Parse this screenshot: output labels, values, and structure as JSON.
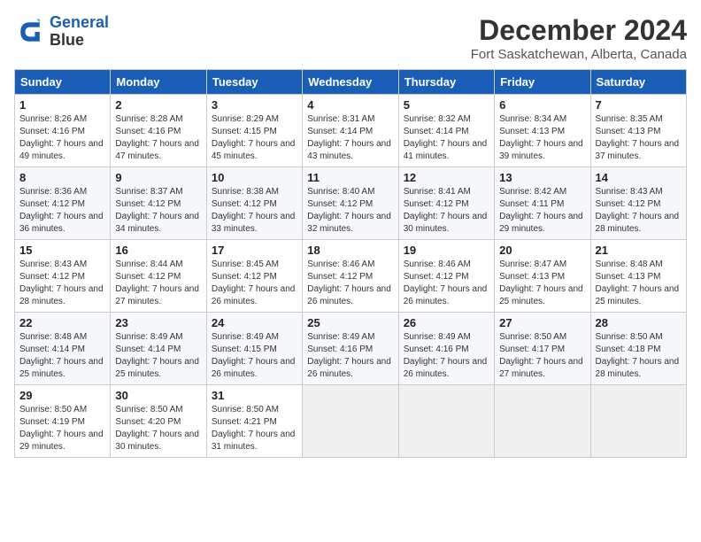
{
  "header": {
    "logo_line1": "General",
    "logo_line2": "Blue",
    "month": "December 2024",
    "location": "Fort Saskatchewan, Alberta, Canada"
  },
  "weekdays": [
    "Sunday",
    "Monday",
    "Tuesday",
    "Wednesday",
    "Thursday",
    "Friday",
    "Saturday"
  ],
  "weeks": [
    [
      {
        "day": "1",
        "sunrise": "Sunrise: 8:26 AM",
        "sunset": "Sunset: 4:16 PM",
        "daylight": "Daylight: 7 hours and 49 minutes."
      },
      {
        "day": "2",
        "sunrise": "Sunrise: 8:28 AM",
        "sunset": "Sunset: 4:16 PM",
        "daylight": "Daylight: 7 hours and 47 minutes."
      },
      {
        "day": "3",
        "sunrise": "Sunrise: 8:29 AM",
        "sunset": "Sunset: 4:15 PM",
        "daylight": "Daylight: 7 hours and 45 minutes."
      },
      {
        "day": "4",
        "sunrise": "Sunrise: 8:31 AM",
        "sunset": "Sunset: 4:14 PM",
        "daylight": "Daylight: 7 hours and 43 minutes."
      },
      {
        "day": "5",
        "sunrise": "Sunrise: 8:32 AM",
        "sunset": "Sunset: 4:14 PM",
        "daylight": "Daylight: 7 hours and 41 minutes."
      },
      {
        "day": "6",
        "sunrise": "Sunrise: 8:34 AM",
        "sunset": "Sunset: 4:13 PM",
        "daylight": "Daylight: 7 hours and 39 minutes."
      },
      {
        "day": "7",
        "sunrise": "Sunrise: 8:35 AM",
        "sunset": "Sunset: 4:13 PM",
        "daylight": "Daylight: 7 hours and 37 minutes."
      }
    ],
    [
      {
        "day": "8",
        "sunrise": "Sunrise: 8:36 AM",
        "sunset": "Sunset: 4:12 PM",
        "daylight": "Daylight: 7 hours and 36 minutes."
      },
      {
        "day": "9",
        "sunrise": "Sunrise: 8:37 AM",
        "sunset": "Sunset: 4:12 PM",
        "daylight": "Daylight: 7 hours and 34 minutes."
      },
      {
        "day": "10",
        "sunrise": "Sunrise: 8:38 AM",
        "sunset": "Sunset: 4:12 PM",
        "daylight": "Daylight: 7 hours and 33 minutes."
      },
      {
        "day": "11",
        "sunrise": "Sunrise: 8:40 AM",
        "sunset": "Sunset: 4:12 PM",
        "daylight": "Daylight: 7 hours and 32 minutes."
      },
      {
        "day": "12",
        "sunrise": "Sunrise: 8:41 AM",
        "sunset": "Sunset: 4:12 PM",
        "daylight": "Daylight: 7 hours and 30 minutes."
      },
      {
        "day": "13",
        "sunrise": "Sunrise: 8:42 AM",
        "sunset": "Sunset: 4:11 PM",
        "daylight": "Daylight: 7 hours and 29 minutes."
      },
      {
        "day": "14",
        "sunrise": "Sunrise: 8:43 AM",
        "sunset": "Sunset: 4:12 PM",
        "daylight": "Daylight: 7 hours and 28 minutes."
      }
    ],
    [
      {
        "day": "15",
        "sunrise": "Sunrise: 8:43 AM",
        "sunset": "Sunset: 4:12 PM",
        "daylight": "Daylight: 7 hours and 28 minutes."
      },
      {
        "day": "16",
        "sunrise": "Sunrise: 8:44 AM",
        "sunset": "Sunset: 4:12 PM",
        "daylight": "Daylight: 7 hours and 27 minutes."
      },
      {
        "day": "17",
        "sunrise": "Sunrise: 8:45 AM",
        "sunset": "Sunset: 4:12 PM",
        "daylight": "Daylight: 7 hours and 26 minutes."
      },
      {
        "day": "18",
        "sunrise": "Sunrise: 8:46 AM",
        "sunset": "Sunset: 4:12 PM",
        "daylight": "Daylight: 7 hours and 26 minutes."
      },
      {
        "day": "19",
        "sunrise": "Sunrise: 8:46 AM",
        "sunset": "Sunset: 4:12 PM",
        "daylight": "Daylight: 7 hours and 26 minutes."
      },
      {
        "day": "20",
        "sunrise": "Sunrise: 8:47 AM",
        "sunset": "Sunset: 4:13 PM",
        "daylight": "Daylight: 7 hours and 25 minutes."
      },
      {
        "day": "21",
        "sunrise": "Sunrise: 8:48 AM",
        "sunset": "Sunset: 4:13 PM",
        "daylight": "Daylight: 7 hours and 25 minutes."
      }
    ],
    [
      {
        "day": "22",
        "sunrise": "Sunrise: 8:48 AM",
        "sunset": "Sunset: 4:14 PM",
        "daylight": "Daylight: 7 hours and 25 minutes."
      },
      {
        "day": "23",
        "sunrise": "Sunrise: 8:49 AM",
        "sunset": "Sunset: 4:14 PM",
        "daylight": "Daylight: 7 hours and 25 minutes."
      },
      {
        "day": "24",
        "sunrise": "Sunrise: 8:49 AM",
        "sunset": "Sunset: 4:15 PM",
        "daylight": "Daylight: 7 hours and 26 minutes."
      },
      {
        "day": "25",
        "sunrise": "Sunrise: 8:49 AM",
        "sunset": "Sunset: 4:16 PM",
        "daylight": "Daylight: 7 hours and 26 minutes."
      },
      {
        "day": "26",
        "sunrise": "Sunrise: 8:49 AM",
        "sunset": "Sunset: 4:16 PM",
        "daylight": "Daylight: 7 hours and 26 minutes."
      },
      {
        "day": "27",
        "sunrise": "Sunrise: 8:50 AM",
        "sunset": "Sunset: 4:17 PM",
        "daylight": "Daylight: 7 hours and 27 minutes."
      },
      {
        "day": "28",
        "sunrise": "Sunrise: 8:50 AM",
        "sunset": "Sunset: 4:18 PM",
        "daylight": "Daylight: 7 hours and 28 minutes."
      }
    ],
    [
      {
        "day": "29",
        "sunrise": "Sunrise: 8:50 AM",
        "sunset": "Sunset: 4:19 PM",
        "daylight": "Daylight: 7 hours and 29 minutes."
      },
      {
        "day": "30",
        "sunrise": "Sunrise: 8:50 AM",
        "sunset": "Sunset: 4:20 PM",
        "daylight": "Daylight: 7 hours and 30 minutes."
      },
      {
        "day": "31",
        "sunrise": "Sunrise: 8:50 AM",
        "sunset": "Sunset: 4:21 PM",
        "daylight": "Daylight: 7 hours and 31 minutes."
      },
      null,
      null,
      null,
      null
    ]
  ]
}
